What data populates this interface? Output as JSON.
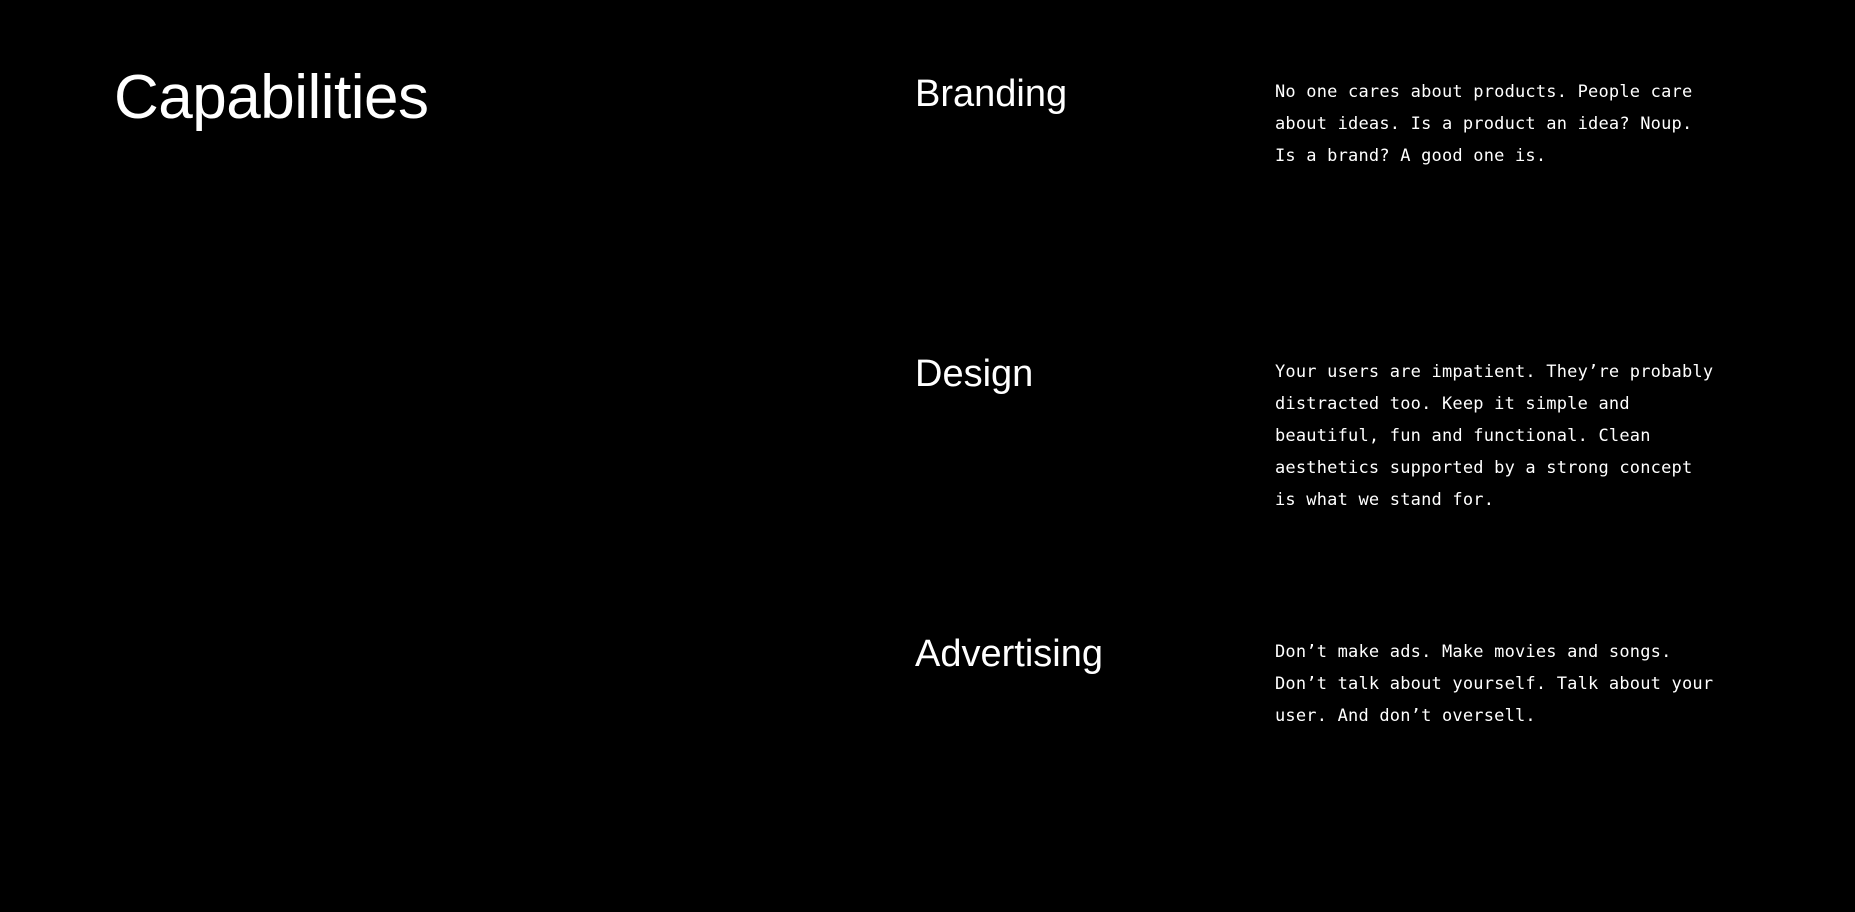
{
  "page_title": "Capabilities",
  "capabilities": [
    {
      "name": "Branding",
      "description": "No one cares about products. People care about ideas. Is a product an idea? Noup. Is a brand? A good one is."
    },
    {
      "name": "Design",
      "description": "Your users are impatient. They’re probably distracted too. Keep it simple and beautiful, fun and functional. Clean aesthetics supported by a strong concept is what we stand for."
    },
    {
      "name": "Advertising",
      "description": "Don’t make ads. Make movies and songs. Don’t talk about yourself. Talk about your user. And don’t oversell."
    }
  ],
  "colors": {
    "background": "#000000",
    "text": "#ffffff"
  }
}
